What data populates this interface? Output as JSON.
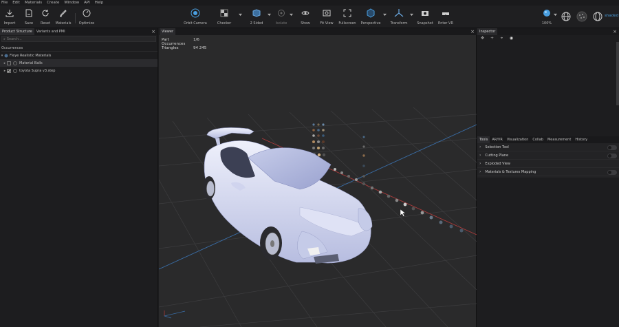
{
  "menu": [
    "File",
    "Edit",
    "Materials",
    "Create",
    "Window",
    "API",
    "Help"
  ],
  "toolbar": {
    "import": "Import",
    "save": "Save",
    "reset": "Reset",
    "materials": "Materials",
    "optimize": "Optimize",
    "orbit_camera": "Orbit Camera",
    "checker": "Checker",
    "two_sided": "2 Sided",
    "isolate": "Isolate",
    "show": "Show",
    "fit_view": "Fit View",
    "fullscreen": "Fullscreen",
    "perspective": "Perspective",
    "transform": "Transform",
    "snapshot": "Snapshot",
    "enter_vr": "Enter VR",
    "zoom": "100%",
    "shaded": "shaded"
  },
  "left_panel": {
    "tabs": [
      "Product Structure",
      "Variants and PMI"
    ],
    "search_placeholder": "Search...",
    "section": "Occurrences",
    "tree": [
      {
        "label": "Fleye Realistic Materials",
        "level": 0
      },
      {
        "label": "Material Balls",
        "level": 1
      },
      {
        "label": "toyota Supra v3.step",
        "level": 1
      }
    ]
  },
  "viewport": {
    "tab": "Viewer",
    "stats": [
      {
        "key": "Part Occurrences",
        "value": "1/6"
      },
      {
        "key": "Triangles",
        "value": "94 245"
      }
    ]
  },
  "right_panel": {
    "tab": "Inspector",
    "tools_tabs": [
      "Tools",
      "AR/VR",
      "Visualization",
      "Collab",
      "Measurement",
      "History"
    ],
    "tools": [
      {
        "label": "Selection Tool",
        "toggle": true
      },
      {
        "label": "Cutting Plane",
        "toggle": true
      },
      {
        "label": "Exploded View",
        "toggle": false
      },
      {
        "label": "Materials & Textures Mapping",
        "toggle": true
      }
    ]
  },
  "colors": {
    "accent": "#4a9fe0",
    "background": "#1b1b1d",
    "viewport": "#2a2a2b",
    "car": "#d7dcf6"
  }
}
